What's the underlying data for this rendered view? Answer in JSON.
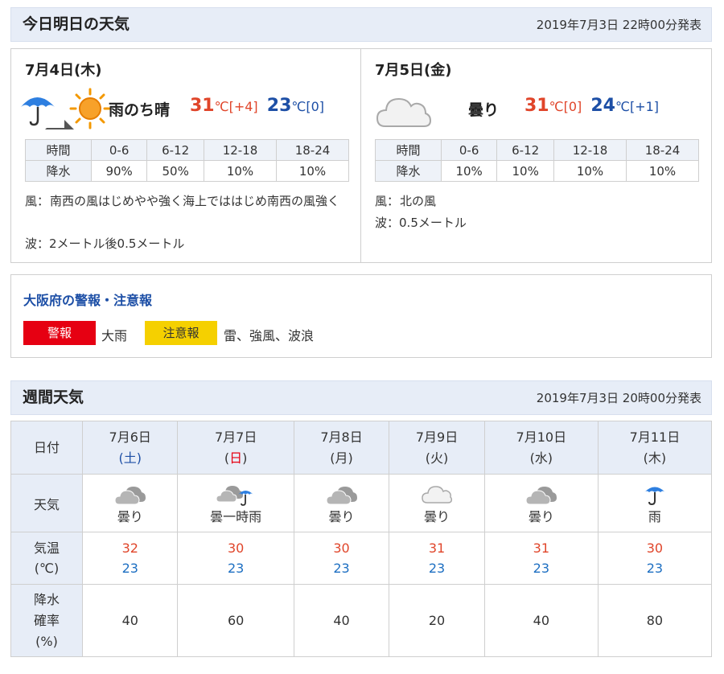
{
  "today_section": {
    "title": "今日明日の天気",
    "issued": "2019年7月3日 22時00分発表"
  },
  "day1": {
    "date": "7月4日(木)",
    "icons": [
      "umbrella-icon",
      "arrow-icon",
      "sun-icon"
    ],
    "weather": "雨のち晴",
    "high": "31",
    "high_unit": "℃",
    "high_diff": "[+4]",
    "low": "23",
    "low_unit": "℃",
    "low_diff": "[0]",
    "pop_header": [
      "時間",
      "0-6",
      "6-12",
      "12-18",
      "18-24"
    ],
    "pop_values": [
      "降水",
      "90%",
      "50%",
      "10%",
      "10%"
    ],
    "wind_label": "風：",
    "wind": "南西の風はじめやや強く海上でははじめ南西の風強く",
    "wave_label": "波：",
    "wave": "2メートル後0.5メートル"
  },
  "day2": {
    "date": "7月5日(金)",
    "icons": [
      "cloud-icon"
    ],
    "weather": "曇り",
    "high": "31",
    "high_unit": "℃",
    "high_diff": "[0]",
    "low": "24",
    "low_unit": "℃",
    "low_diff": "[+1]",
    "pop_header": [
      "時間",
      "0-6",
      "6-12",
      "12-18",
      "18-24"
    ],
    "pop_values": [
      "降水",
      "10%",
      "10%",
      "10%",
      "10%"
    ],
    "wind_label": "風：",
    "wind": "北の風",
    "wave_label": "波：",
    "wave": "0.5メートル"
  },
  "warnings": {
    "title": "大阪府の警報・注意報",
    "warning_label": "警報",
    "warning_text": "大雨",
    "advisory_label": "注意報",
    "advisory_text": "雷、強風、波浪"
  },
  "weekly_section": {
    "title": "週間天気",
    "issued": "2019年7月3日 20時00分発表"
  },
  "weekly": {
    "row_labels": {
      "date": "日付",
      "weather": "天気",
      "temp_line1": "気温",
      "temp_line2": "(℃)",
      "rain_line1": "降水",
      "rain_line2": "確率",
      "rain_line3": "(%)"
    },
    "days": [
      {
        "date": "7月6日",
        "dow": "(土)",
        "icon": "cloud-dark-icon",
        "weather": "曇り",
        "high": "32",
        "low": "23",
        "pop": "40"
      },
      {
        "date": "7月7日",
        "dow": "(日)",
        "icon": "cloud-umbrella-icon",
        "weather": "曇一時雨",
        "high": "30",
        "low": "23",
        "pop": "60"
      },
      {
        "date": "7月8日",
        "dow": "(月)",
        "icon": "cloud-dark-icon",
        "weather": "曇り",
        "high": "30",
        "low": "23",
        "pop": "40"
      },
      {
        "date": "7月9日",
        "dow": "(火)",
        "icon": "cloud-light-icon",
        "weather": "曇り",
        "high": "31",
        "low": "23",
        "pop": "20"
      },
      {
        "date": "7月10日",
        "dow": "(水)",
        "icon": "cloud-dark-icon",
        "weather": "曇り",
        "high": "31",
        "low": "23",
        "pop": "40"
      },
      {
        "date": "7月11日",
        "dow": "(木)",
        "icon": "umbrella-icon",
        "weather": "雨",
        "high": "30",
        "low": "23",
        "pop": "80"
      }
    ]
  },
  "colors": {
    "high": "#e0452a",
    "low": "#1d4fa6",
    "warning": "#e60012",
    "advisory": "#f5d000",
    "header_bg": "#e7edf7"
  }
}
